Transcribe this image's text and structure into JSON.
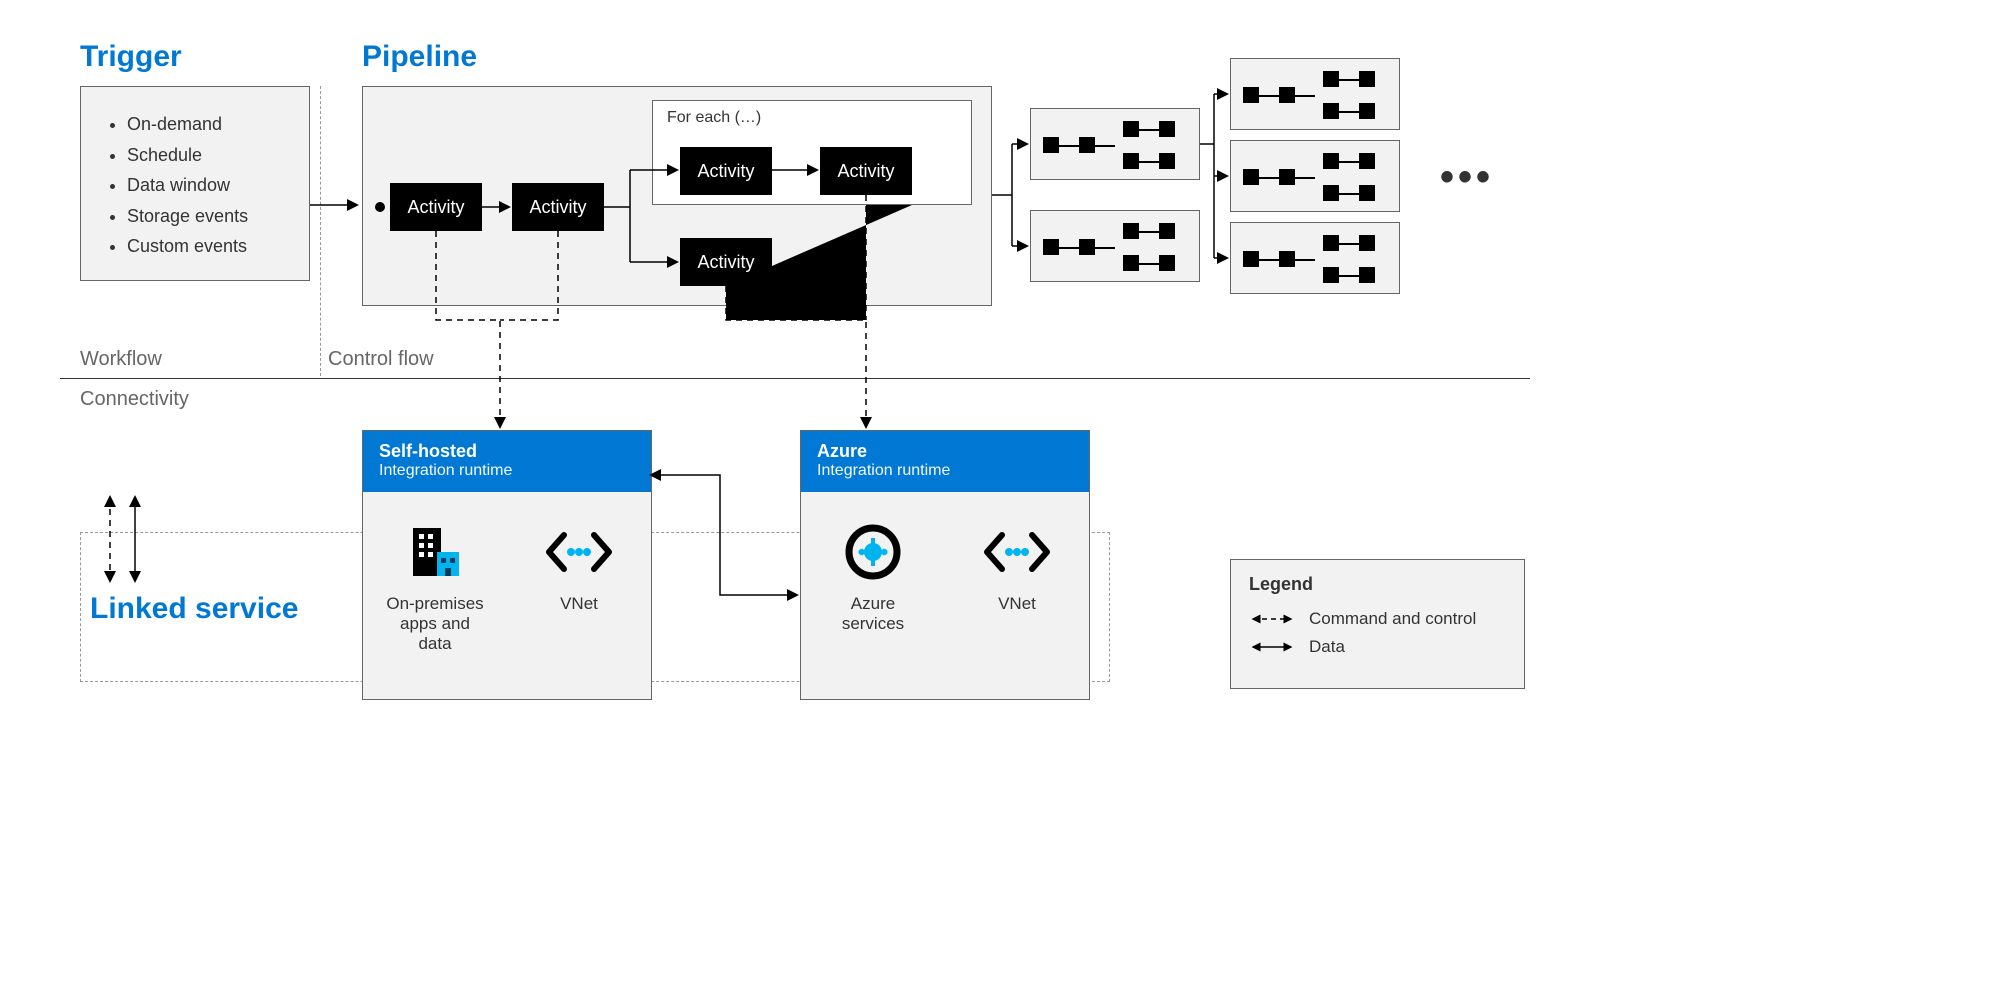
{
  "headings": {
    "trigger": "Trigger",
    "pipeline": "Pipeline",
    "linked_service": "Linked service"
  },
  "trigger_items": [
    "On-demand",
    "Schedule",
    "Data window",
    "Storage events",
    "Custom events"
  ],
  "labels": {
    "workflow": "Workflow",
    "control_flow": "Control flow",
    "connectivity": "Connectivity",
    "foreach": "For each (…)",
    "activity": "Activity",
    "more": "•••"
  },
  "ir": {
    "self": {
      "title": "Self-hosted",
      "sub": "Integration runtime",
      "item1": "On-premises apps and data",
      "item2": "VNet"
    },
    "azure": {
      "title": "Azure",
      "sub": "Integration runtime",
      "item1": "Azure services",
      "item2": "VNet"
    }
  },
  "legend": {
    "title": "Legend",
    "cmd": "Command and control",
    "data": "Data"
  }
}
